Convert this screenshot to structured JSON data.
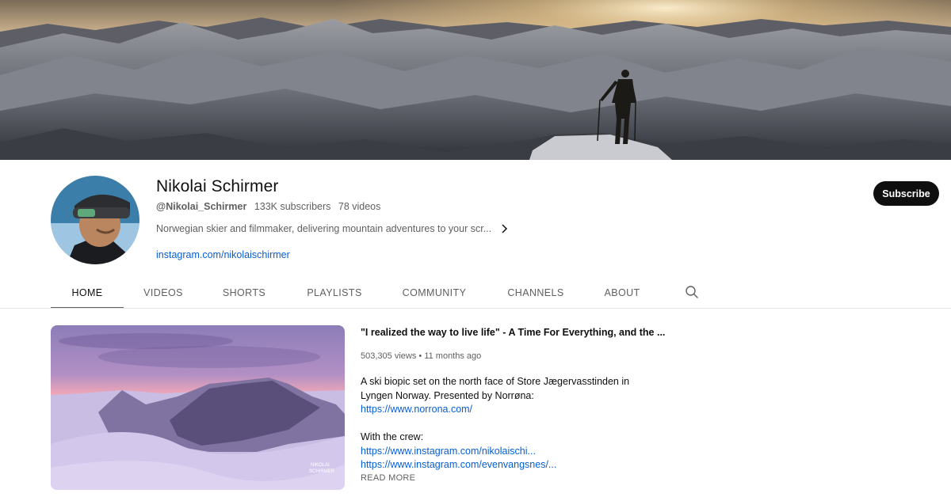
{
  "channel": {
    "name": "Nikolai Schirmer",
    "handle": "@Nikolai_Schirmer",
    "subscribers": "133K subscribers",
    "videos": "78 videos",
    "description": "Norwegian skier and filmmaker, delivering mountain adventures to your scr...",
    "link": "instagram.com/nikolaischirmer",
    "subscribe_label": "Subscribe"
  },
  "tabs": [
    {
      "label": "HOME",
      "active": true
    },
    {
      "label": "VIDEOS",
      "active": false
    },
    {
      "label": "SHORTS",
      "active": false
    },
    {
      "label": "PLAYLISTS",
      "active": false
    },
    {
      "label": "COMMUNITY",
      "active": false
    },
    {
      "label": "CHANNELS",
      "active": false
    },
    {
      "label": "ABOUT",
      "active": false
    }
  ],
  "icons": {
    "search": "search-icon",
    "chevron": "chevron-right-icon"
  },
  "featured": {
    "title": "\"I realized the way to live life\" - A Time For Everything, and the ...",
    "views": "503,305 views",
    "separator": "•",
    "age": "11 months ago",
    "description_lines": [
      {
        "text": "A ski biopic set on the north face of Store Jægervasstinden in",
        "link": false
      },
      {
        "text": "Lyngen Norway. Presented by Norrøna:",
        "link": false
      },
      {
        "text": "https://www.norrona.com/",
        "link": true
      },
      {
        "text": "",
        "link": false
      },
      {
        "text": "With the crew:",
        "link": false
      },
      {
        "text": "https://www.instagram.com/nikolaischi...",
        "link": true
      },
      {
        "text": "https://www.instagram.com/evenvangsnes/...",
        "link": true
      }
    ],
    "read_more": "READ MORE",
    "watermark_line1": "NIKOLAI",
    "watermark_line2": "SCHIRMER"
  },
  "colors": {
    "accent_link": "#065fd4",
    "subscribe_bg": "#0f0f0f",
    "secondary_text": "#606060"
  }
}
